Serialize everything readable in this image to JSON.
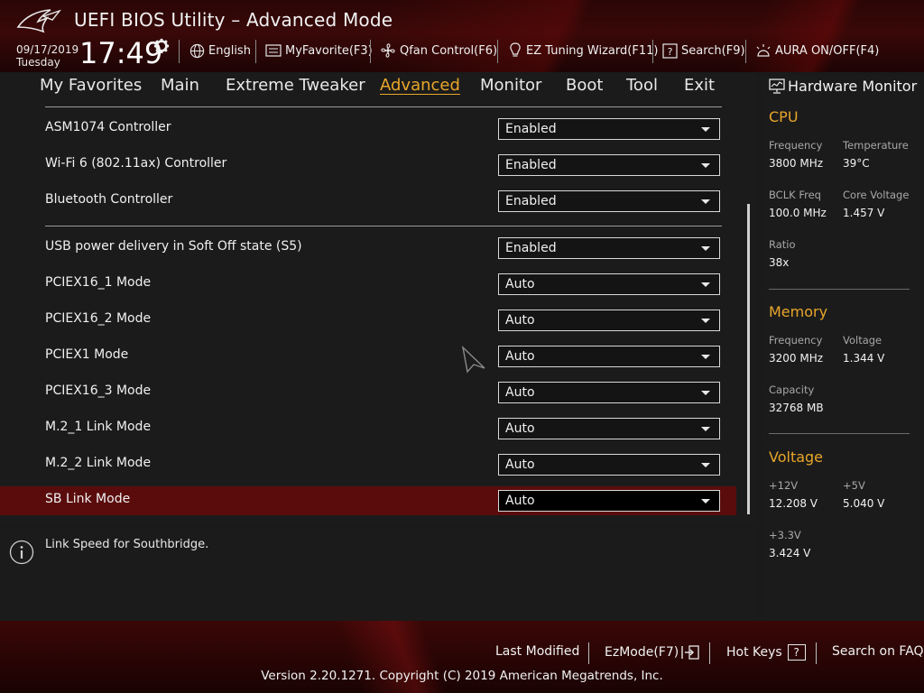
{
  "header": {
    "title": "UEFI BIOS Utility – Advanced Mode",
    "date": "09/17/2019",
    "day": "Tuesday",
    "time": "17:49",
    "toolbar": {
      "language": "English",
      "myfavorite": "MyFavorite(F3)",
      "qfan": "Qfan Control(F6)",
      "ez_tuning": "EZ Tuning Wizard(F11)",
      "search": "Search(F9)",
      "aura": "AURA ON/OFF(F4)"
    }
  },
  "tabs": {
    "items": [
      {
        "label": "My Favorites"
      },
      {
        "label": "Main"
      },
      {
        "label": "Extreme Tweaker"
      },
      {
        "label": "Advanced"
      },
      {
        "label": "Monitor"
      },
      {
        "label": "Boot"
      },
      {
        "label": "Tool"
      },
      {
        "label": "Exit"
      }
    ],
    "active": "Advanced"
  },
  "settings": {
    "rows": [
      {
        "label": "ASM1074 Controller",
        "value": "Enabled"
      },
      {
        "label": "Wi-Fi 6 (802.11ax) Controller",
        "value": "Enabled"
      },
      {
        "label": "Bluetooth Controller",
        "value": "Enabled"
      },
      {
        "label": "USB power delivery in Soft Off state (S5)",
        "value": "Enabled"
      },
      {
        "label": "PCIEX16_1 Mode",
        "value": "Auto"
      },
      {
        "label": "PCIEX16_2 Mode",
        "value": "Auto"
      },
      {
        "label": "PCIEX1 Mode",
        "value": "Auto"
      },
      {
        "label": "PCIEX16_3 Mode",
        "value": "Auto"
      },
      {
        "label": "M.2_1 Link Mode",
        "value": "Auto"
      },
      {
        "label": "M.2_2 Link Mode",
        "value": "Auto"
      },
      {
        "label": "SB Link Mode",
        "value": "Auto"
      }
    ],
    "selected": "SB Link Mode"
  },
  "help": {
    "text": "Link Speed for Southbridge."
  },
  "hardware_monitor": {
    "title": "Hardware Monitor",
    "cpu": {
      "heading": "CPU",
      "frequency_label": "Frequency",
      "frequency_value": "3800 MHz",
      "temperature_label": "Temperature",
      "temperature_value": "39°C",
      "bclk_label": "BCLK Freq",
      "bclk_value": "100.0 MHz",
      "core_voltage_label": "Core Voltage",
      "core_voltage_value": "1.457 V",
      "ratio_label": "Ratio",
      "ratio_value": "38x"
    },
    "memory": {
      "heading": "Memory",
      "frequency_label": "Frequency",
      "frequency_value": "3200 MHz",
      "voltage_label": "Voltage",
      "voltage_value": "1.344 V",
      "capacity_label": "Capacity",
      "capacity_value": "32768 MB"
    },
    "voltage": {
      "heading": "Voltage",
      "v12_label": "+12V",
      "v12_value": "12.208 V",
      "v5_label": "+5V",
      "v5_value": "5.040 V",
      "v33_label": "+3.3V",
      "v33_value": "3.424 V"
    }
  },
  "footer": {
    "last_modified": "Last Modified",
    "ezmode": "EzMode(F7)",
    "hot_keys": "Hot Keys",
    "hot_keys_symbol": "?",
    "search_faq": "Search on FAQ",
    "version": "Version 2.20.1271. Copyright (C) 2019 American Megatrends, Inc."
  },
  "colors": {
    "accent": "#e8a62a",
    "selected_row": "#5a0c0c",
    "header_red": "#3a0808"
  },
  "icons": [
    "rog-logo-icon",
    "gear-icon",
    "globe-icon",
    "keyboard-icon",
    "fan-icon",
    "lightbulb-icon",
    "search-icon",
    "aura-icon",
    "monitor-icon",
    "info-icon",
    "exit-arrow-icon"
  ]
}
